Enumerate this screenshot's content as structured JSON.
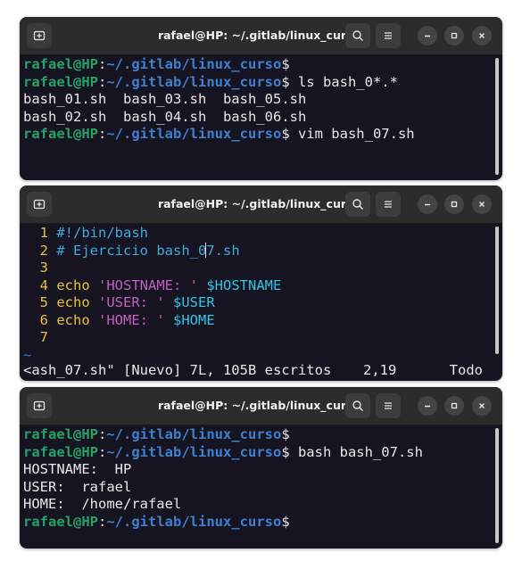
{
  "windows": [
    {
      "title": "rafael@HP: ~/.gitlab/linux_curso",
      "lines": [
        {
          "user": "rafael@HP",
          "path": "~/.gitlab/linux_curso",
          "cmd": "$"
        },
        {
          "user": "rafael@HP",
          "path": "~/.gitlab/linux_curso",
          "cmd": "$ ls bash_0*.*"
        },
        {
          "text": "bash_01.sh  bash_03.sh  bash_05.sh"
        },
        {
          "text": "bash_02.sh  bash_04.sh  bash_06.sh"
        },
        {
          "user": "rafael@HP",
          "path": "~/.gitlab/linux_curso",
          "cmd": "$ vim bash_07.sh"
        }
      ]
    },
    {
      "title": "rafael@HP: ~/.gitlab/linux_curso",
      "vim": {
        "lines": [
          {
            "num": "1",
            "comment": "#!/bin/bash"
          },
          {
            "num": "2",
            "comment_a": "# Ejercicio bash_0",
            "comment_b": "7.sh"
          },
          {
            "num": "3"
          },
          {
            "num": "4",
            "kw": "echo",
            "str": "'HOSTNAME: '",
            "var": "$HOSTNAME"
          },
          {
            "num": "5",
            "kw": "echo",
            "str": "'USER: '",
            "var": "$USER"
          },
          {
            "num": "6",
            "kw": "echo",
            "str": "'HOME: '",
            "var": "$HOME"
          },
          {
            "num": "7"
          }
        ],
        "tilde": "~",
        "status_left": "<ash_07.sh\" [Nuevo] 7L, 105B escritos",
        "status_pos": "2,19",
        "status_right": "Todo"
      }
    },
    {
      "title": "rafael@HP: ~/.gitlab/linux_curso",
      "lines": [
        {
          "user": "rafael@HP",
          "path": "~/.gitlab/linux_curso",
          "cmd": "$"
        },
        {
          "user": "rafael@HP",
          "path": "~/.gitlab/linux_curso",
          "cmd": "$ bash bash_07.sh"
        },
        {
          "text": "HOSTNAME:  HP"
        },
        {
          "text": "USER:  rafael"
        },
        {
          "text": "HOME:  /home/rafael"
        },
        {
          "user": "rafael@HP",
          "path": "~/.gitlab/linux_curso",
          "cmd": "$"
        }
      ]
    }
  ],
  "icons": {
    "new_tab": "new-tab-icon",
    "search": "search-icon",
    "menu": "hamburger-menu-icon",
    "minimize": "minimize-icon",
    "maximize": "maximize-icon",
    "close": "close-icon"
  },
  "colors": {
    "terminal_bg": "#171421",
    "titlebar_bg": "#2c2c2c",
    "prompt_user": "#26a269",
    "prompt_path": "#3f7fd0",
    "vim_line_number": "#e5c23b",
    "vim_string": "#c05fc0",
    "vim_variable": "#33c3e8"
  }
}
